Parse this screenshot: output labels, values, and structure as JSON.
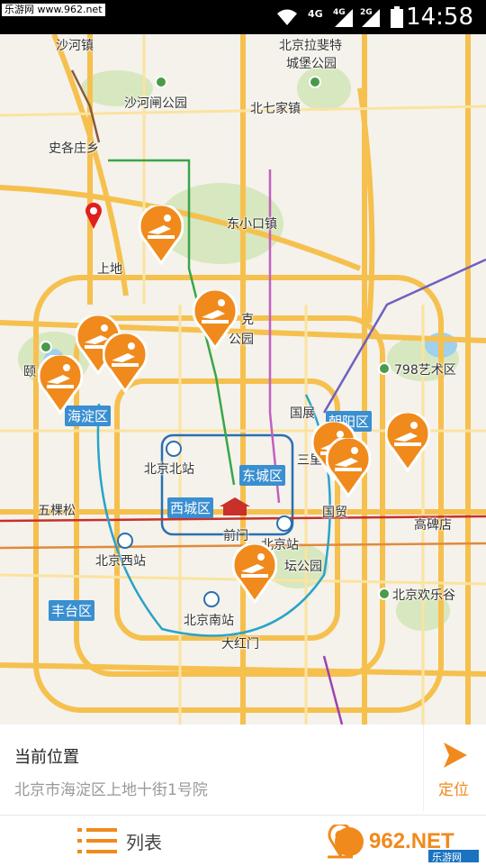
{
  "status_bar": {
    "watermark": "乐游网 www.962.net",
    "signal_labels": [
      "4G",
      "4G",
      "2G"
    ],
    "time": "14:58"
  },
  "map": {
    "labels": {
      "shahe": "沙河镇",
      "lafeite": "北京拉斐特",
      "lafeite2": "城堡公园",
      "shahezha": "沙河闸公园",
      "beiqijia": "北七家镇",
      "shigezhuang": "史各庄乡",
      "dongxiaokou": "东小口镇",
      "shangdi": "上地",
      "ke": "克",
      "park_partial": "公园",
      "yi": "颐",
      "art798": "798艺术区",
      "haidian": "海淀区",
      "chaoyang": "朝阳区",
      "guozhan": "国展",
      "beijingbei": "北京北站",
      "dongcheng": "东城区",
      "sanli": "三里",
      "wukesong": "五棵松",
      "xicheng": "西城区",
      "qianmen": "前门",
      "guomao": "国贸",
      "gaobeidian": "高碑店",
      "beijingxi": "北京西站",
      "beijingzhan": "北京站",
      "tan": "坛公园",
      "fengtai": "丰台区",
      "huanlegu": "北京欢乐谷",
      "beijingnan": "北京南站",
      "dahongmen": "大红门"
    },
    "markers": [
      "massage-marker",
      "massage-marker",
      "massage-marker",
      "massage-marker",
      "massage-marker",
      "massage-marker",
      "massage-marker",
      "massage-marker",
      "massage-marker"
    ],
    "location_pin": "location-pin-icon"
  },
  "current_location": {
    "title": "当前位置",
    "address": "北京市海淀区上地十街1号院",
    "locate_label": "定位",
    "locate_icon": "arrow-locate-icon"
  },
  "tabbar": {
    "list_label": "列表",
    "list_icon": "list-icon",
    "map_icon": "map-pin-icon",
    "brand_text": "962.NET",
    "brand_sub": "乐游网"
  },
  "colors": {
    "accent": "#f08a1c",
    "district_label": "#3a8fd0",
    "road_major": "#f6c04f",
    "background": "#f4f2ea"
  }
}
